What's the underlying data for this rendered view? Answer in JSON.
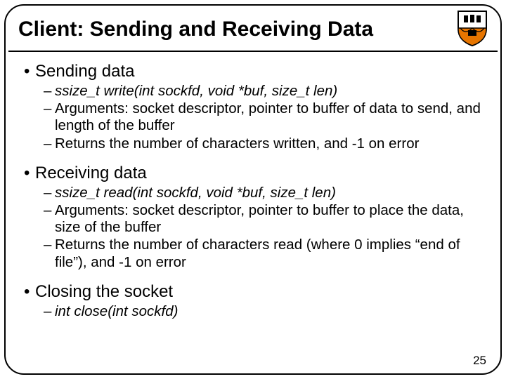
{
  "title": "Client: Sending and Receiving Data",
  "page_number": "25",
  "sections": {
    "sending": {
      "heading": "Sending data",
      "sig": "ssize_t write(int sockfd, void *buf, size_t len)",
      "args": "Arguments: socket descriptor, pointer to buffer of data to send, and length of the buffer",
      "ret": "Returns the number of characters written, and -1 on error"
    },
    "receiving": {
      "heading": "Receiving data",
      "sig": "ssize_t read(int sockfd, void *buf, size_t len)",
      "args": "Arguments: socket descriptor, pointer to buffer to place the data, size of the buffer",
      "ret": "Returns the number of characters read (where 0 implies “end of file”), and -1 on error"
    },
    "closing": {
      "heading": "Closing the socket",
      "sig": "int close(int sockfd)"
    }
  },
  "logo": {
    "name": "princeton-shield-icon",
    "primary": "#000000",
    "accent": "#e77500"
  }
}
